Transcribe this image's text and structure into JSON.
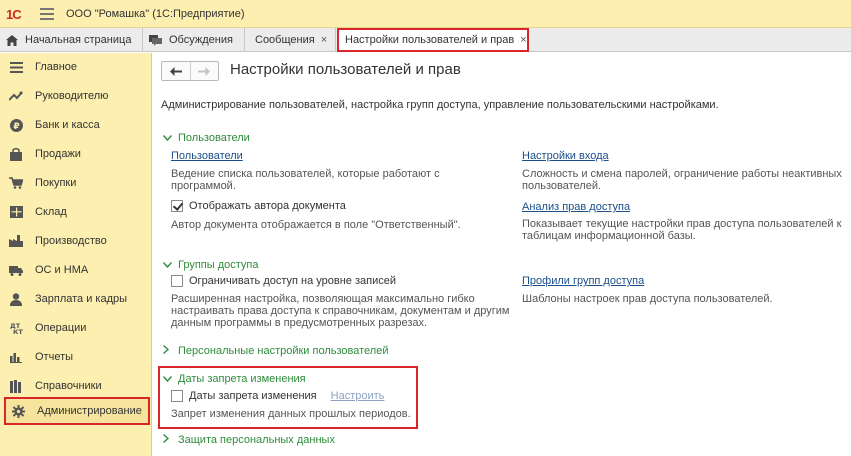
{
  "titlebar": {
    "logo": "1С",
    "title": "ООО \"Ромашка\"  (1С:Предприятие)"
  },
  "tabs": [
    {
      "label": "Начальная страница",
      "icon": "home-icon"
    },
    {
      "label": "Обсуждения",
      "icon": "chat-icon"
    },
    {
      "label": "Сообщения",
      "close": "×"
    },
    {
      "label": "Настройки пользователей и прав",
      "close": "×"
    }
  ],
  "sidebar": {
    "items": [
      {
        "label": "Главное",
        "icon": "menu-icon"
      },
      {
        "label": "Руководителю",
        "icon": "trend-icon"
      },
      {
        "label": "Банк и касса",
        "icon": "ruble-icon"
      },
      {
        "label": "Продажи",
        "icon": "bag-icon"
      },
      {
        "label": "Покупки",
        "icon": "cart-icon"
      },
      {
        "label": "Склад",
        "icon": "warehouse-icon"
      },
      {
        "label": "Производство",
        "icon": "factory-icon"
      },
      {
        "label": "ОС и НМА",
        "icon": "truck-icon"
      },
      {
        "label": "Зарплата и кадры",
        "icon": "person-icon"
      },
      {
        "label": "Операции",
        "icon": "operations-icon"
      },
      {
        "label": "Отчеты",
        "icon": "bar-chart-icon"
      },
      {
        "label": "Справочники",
        "icon": "books-icon"
      },
      {
        "label": "Администрирование",
        "icon": "gear-icon"
      }
    ],
    "active_index": 12
  },
  "page": {
    "title": "Настройки пользователей и прав",
    "description": "Администрирование пользователей, настройка групп доступа, управление пользовательскими настройками."
  },
  "users_section": {
    "header": "Пользователи",
    "users_link": "Пользователи",
    "users_hint_1": "Ведение списка пользователей, которые работают с",
    "users_hint_2": "программой.",
    "show_author_label": "Отображать автора документа",
    "show_author_checked": true,
    "show_author_hint": "Автор документа отображается в поле \"Ответственный\".",
    "login_link": "Настройки входа",
    "login_hint_1": "Сложность и смена паролей, ограничение работы неактивных",
    "login_hint_2": "пользователей.",
    "analysis_link": "Анализ прав доступа",
    "analysis_hint_1": "Показывает текущие настройки прав доступа пользователей к",
    "analysis_hint_2": "таблицам информационной базы."
  },
  "groups_section": {
    "header": "Группы доступа",
    "restrict_label": "Ограничивать доступ на уровне записей",
    "restrict_checked": false,
    "restrict_hint_1": "Расширенная настройка, позволяющая максимально гибко",
    "restrict_hint_2": "настраивать права доступа к справочникам, документам и другим",
    "restrict_hint_3": "данным программы в предусмотренных разрезах.",
    "profiles_link": "Профили групп доступа",
    "profiles_hint": "Шаблоны настроек прав доступа пользователей."
  },
  "personal_section": {
    "header": "Персональные настройки пользователей"
  },
  "lock_section": {
    "header": "Даты запрета изменения",
    "lock_label": "Даты запрета изменения",
    "lock_checked": false,
    "configure_link": "Настроить",
    "lock_hint": "Запрет изменения данных прошлых периодов."
  },
  "privacy_section": {
    "header": "Защита персональных данных"
  },
  "colors": {
    "accent_yellow": "#fcefb0",
    "section_green": "#2f8c3c",
    "link_blue": "#1a4f8a",
    "highlight_red": "#d9262b"
  }
}
